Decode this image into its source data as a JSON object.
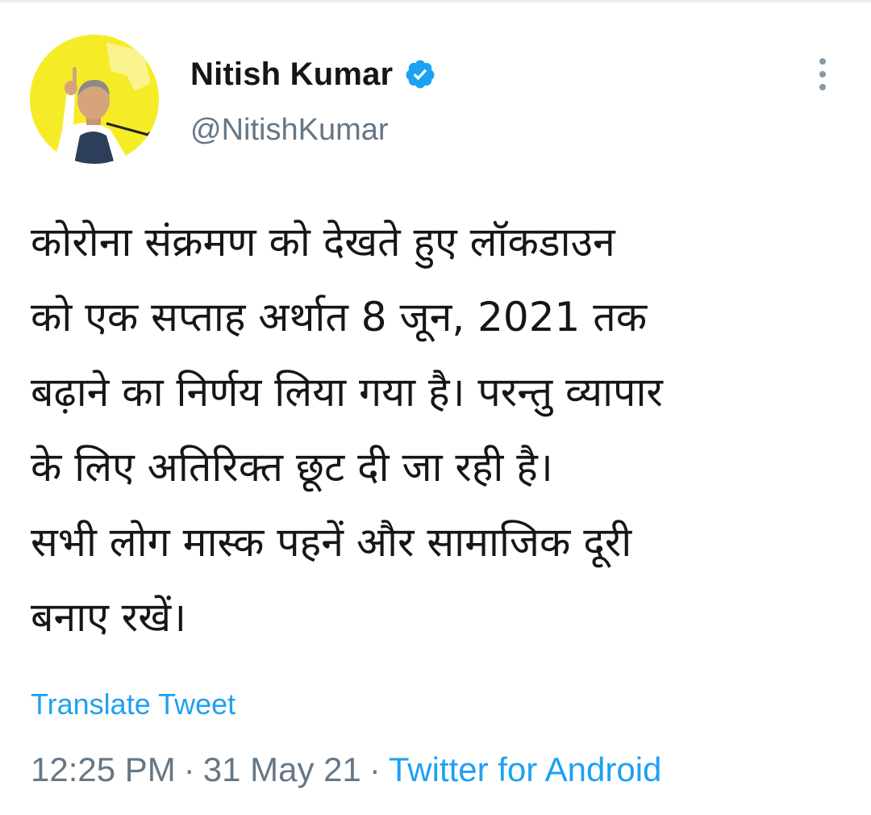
{
  "author": {
    "display_name": "Nitish Kumar",
    "handle": "@NitishKumar",
    "verified": true
  },
  "tweet": {
    "lines": [
      "कोरोना संक्रमण को देखते हुए लॉकडाउन",
      "को एक सप्ताह अर्थात 8 जून, 2021 तक",
      "बढ़ाने का निर्णय लिया गया है। परन्तु व्यापार",
      "के लिए अतिरिक्त छूट दी जा रही है।",
      "सभी लोग मास्क पहनें और सामाजिक दूरी",
      "बनाए रखें।"
    ]
  },
  "translate_label": "Translate Tweet",
  "meta": {
    "time": "12:25 PM",
    "separator": "·",
    "date": "31 May 21",
    "source": "Twitter for Android"
  },
  "colors": {
    "link_blue": "#1da1f2",
    "verified_blue": "#1da1f2",
    "text_primary": "#14171a",
    "text_secondary": "#657786",
    "avatar_bg": "#f5ec27"
  },
  "icons": {
    "verified": "verified-badge-icon",
    "more": "more-vertical-icon"
  }
}
